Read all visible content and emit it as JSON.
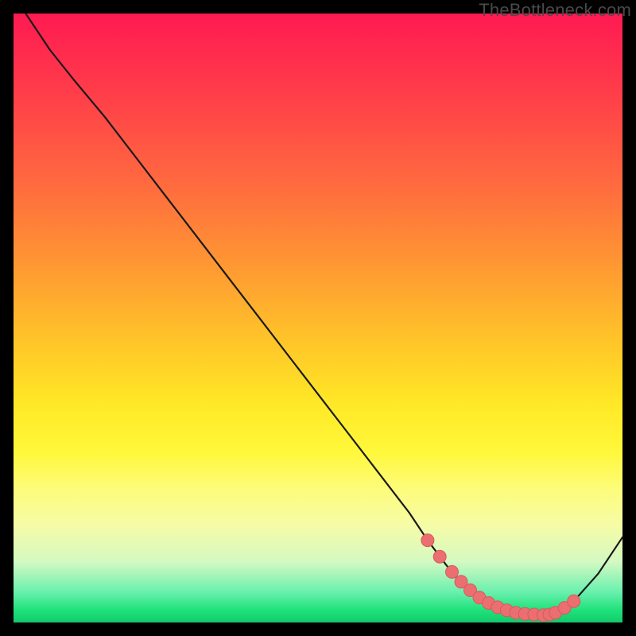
{
  "watermark": "TheBottleneck.com",
  "colors": {
    "curve_stroke": "#1a1a1a",
    "marker_fill": "#eb6f70",
    "marker_stroke": "#d65a5e"
  },
  "chart_data": {
    "type": "line",
    "title": "",
    "xlabel": "",
    "ylabel": "",
    "xrange": [
      0,
      100
    ],
    "yrange": [
      0,
      100
    ],
    "grid": false,
    "legend": false,
    "series": [
      {
        "name": "bottleneck-curve",
        "x": [
          2,
          6,
          10,
          15,
          20,
          25,
          30,
          35,
          40,
          45,
          50,
          55,
          60,
          65,
          68,
          71,
          73,
          75,
          77,
          79,
          81,
          83,
          85,
          87,
          89,
          92,
          96,
          100
        ],
        "y": [
          100,
          94,
          89,
          83,
          76.5,
          70,
          63.5,
          57,
          50.5,
          44,
          37.5,
          31,
          24.5,
          18,
          13.5,
          9.5,
          7,
          5,
          3.5,
          2.5,
          1.8,
          1.4,
          1.2,
          1.2,
          1.6,
          3.5,
          8,
          14
        ]
      }
    ],
    "markers": {
      "name": "highlighted-points",
      "x": [
        68,
        70,
        72,
        73.5,
        75,
        76.5,
        78,
        79.5,
        81,
        82.5,
        84,
        85.5,
        87,
        88,
        89,
        90.5,
        92
      ],
      "y": [
        13.5,
        10.8,
        8.3,
        6.7,
        5.3,
        4.1,
        3.2,
        2.5,
        2.0,
        1.6,
        1.4,
        1.3,
        1.2,
        1.3,
        1.6,
        2.4,
        3.5
      ]
    }
  }
}
